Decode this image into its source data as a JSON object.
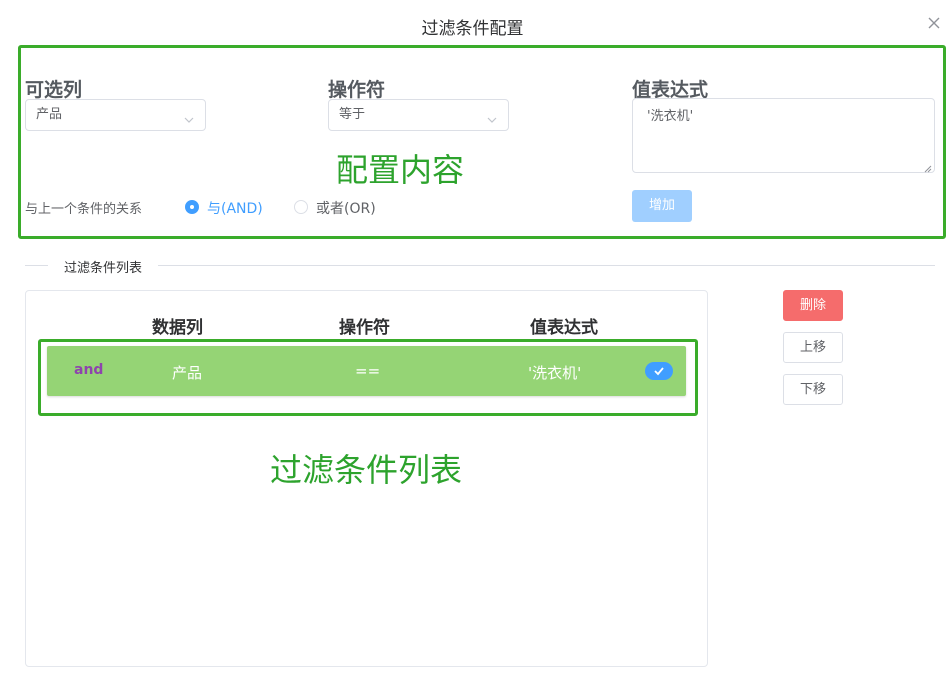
{
  "dialog": {
    "title": "过滤条件配置"
  },
  "config": {
    "column_label": "可选列",
    "column_selected": "产品",
    "operator_label": "操作符",
    "operator_selected": "等于",
    "value_label": "值表达式",
    "value_text": "'洗衣机'",
    "relation_label": "与上一个条件的关系",
    "relation_and": "与(AND)",
    "relation_or": "或者(OR)",
    "relation_selected": "and",
    "add_button": "增加"
  },
  "annotations": {
    "config_area": "配置内容",
    "list_area": "过滤条件列表"
  },
  "list": {
    "divider_title": "过滤条件列表",
    "headers": [
      "数据列",
      "操作符",
      "值表达式"
    ],
    "rows": [
      {
        "relation": "and",
        "column": "产品",
        "operator": "==",
        "value": "'洗衣机'",
        "checked": true
      }
    ]
  },
  "side_buttons": {
    "delete": "删除",
    "move_up": "上移",
    "move_down": "下移"
  },
  "colors": {
    "primary": "#409eff",
    "row_bg": "#95d475",
    "annotation": "#2da32d",
    "danger": "#f56c6c",
    "relation_text": "#8e44ad"
  }
}
